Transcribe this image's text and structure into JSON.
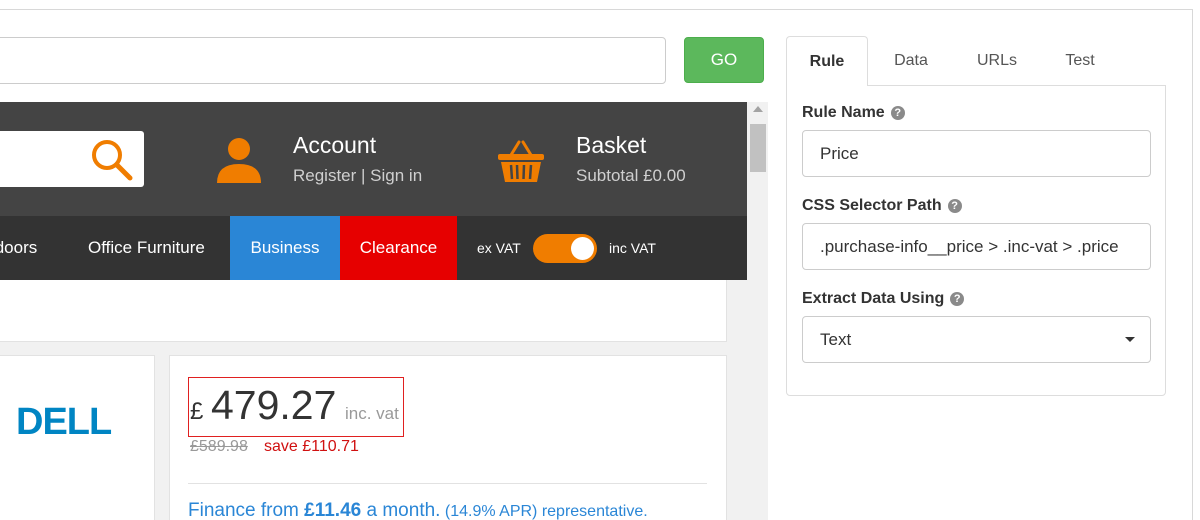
{
  "toolbar": {
    "url_value": "",
    "go_label": "GO"
  },
  "site": {
    "header": {
      "account_title": "Account",
      "account_sub": "Register | Sign in",
      "basket_title": "Basket",
      "basket_sub": "Subtotal £0.00"
    },
    "nav": {
      "items": [
        "tdoors",
        "Office Furniture",
        "Business",
        "Clearance"
      ],
      "vat_ex": "ex VAT",
      "vat_inc": "inc VAT",
      "vat_toggle_on": true
    },
    "product": {
      "brand_logo": "DELL",
      "currency": "£",
      "price": "479.27",
      "price_suffix": "inc. vat",
      "old_price": "£589.98",
      "save": "save £110.71",
      "finance_prefix": "Finance from ",
      "finance_amount": "£11.46",
      "finance_mid": " a month.",
      "finance_apr": " (14.9% APR) representative."
    }
  },
  "panel": {
    "tabs": [
      "Rule",
      "Data",
      "URLs",
      "Test"
    ],
    "active_tab": "Rule",
    "rule_name_label": "Rule Name",
    "rule_name_value": "Price",
    "css_selector_label": "CSS Selector Path",
    "css_selector_value": ".purchase-info__price > .inc-vat > .price",
    "extract_label": "Extract Data Using",
    "extract_value": "Text"
  },
  "colors": {
    "go_green": "#5cb85c",
    "brand_orange": "#f07d00",
    "business_blue": "#2a86d6",
    "clearance_red": "#e60000",
    "highlight_red": "#e02020",
    "header_dark": "#444444"
  }
}
